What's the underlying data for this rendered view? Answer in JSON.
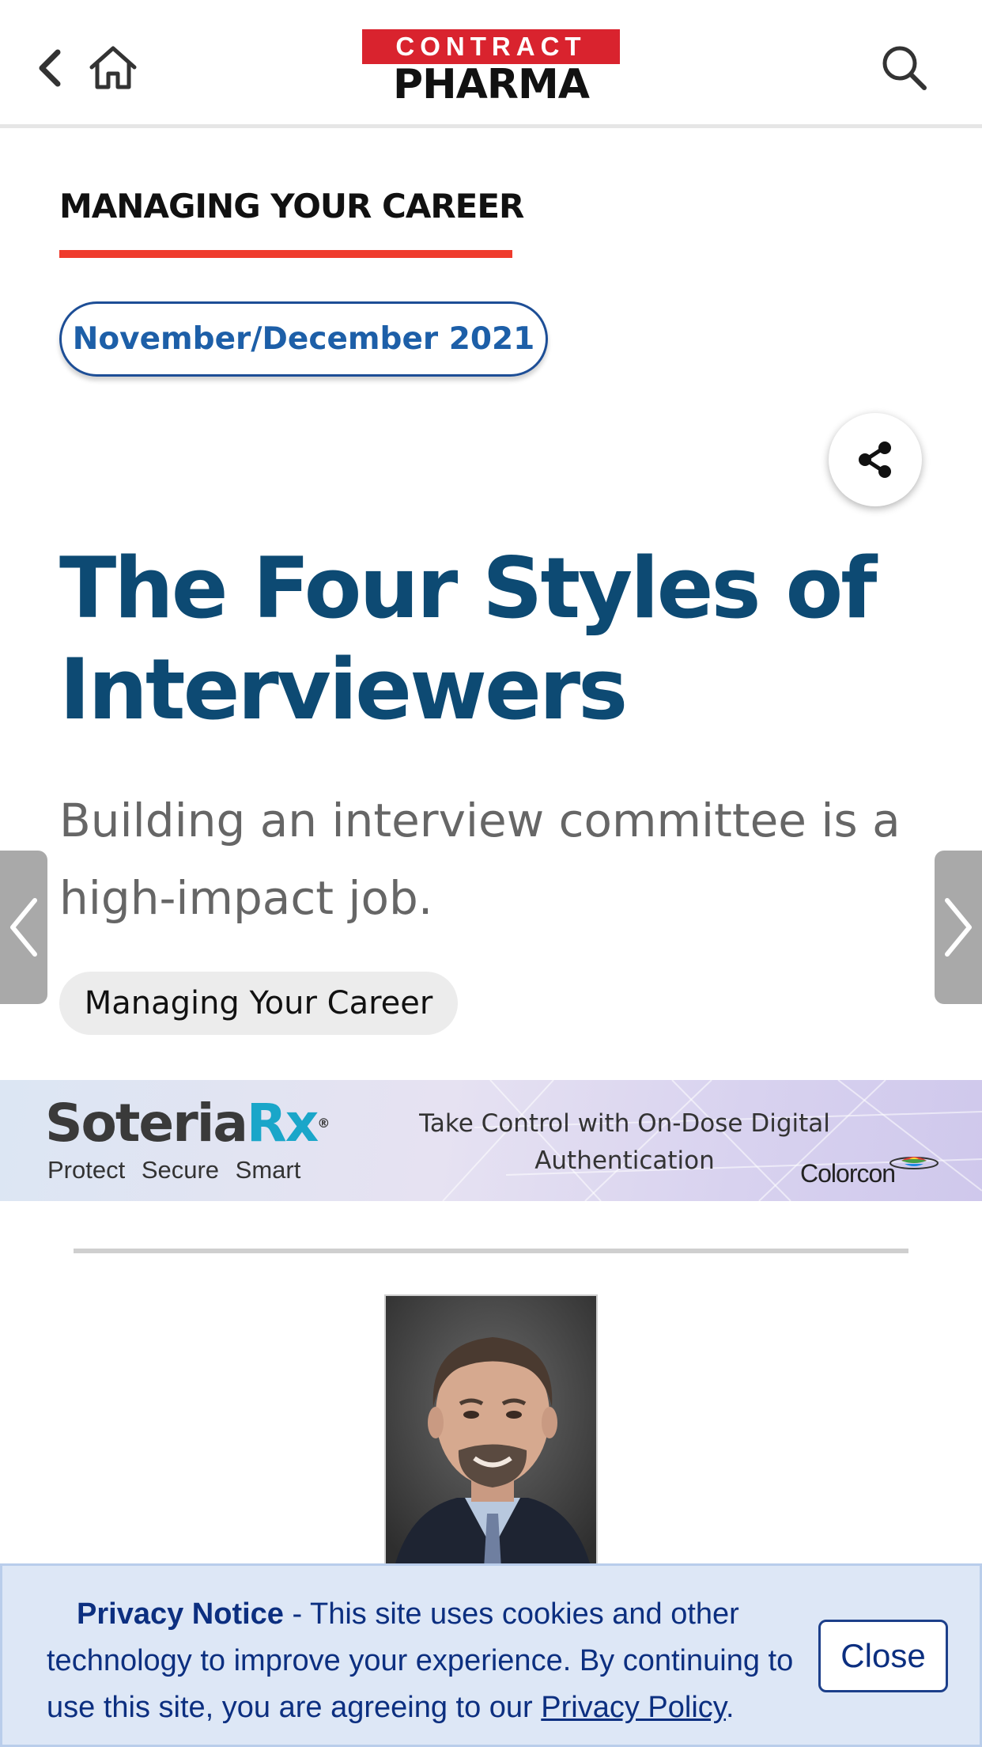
{
  "header": {
    "logo_top": "CONTRACT",
    "logo_bottom": "PHARMA",
    "back_icon": "chevron-left-icon",
    "home_icon": "home-icon",
    "search_icon": "search-icon"
  },
  "article": {
    "section": "MANAGING YOUR CAREER",
    "issue": "November/December 2021",
    "title": "The Four Styles of Interviewers",
    "subtitle": "Building an interview committee is a high-impact job.",
    "tag": "Managing Your Career",
    "share_icon": "share-icon"
  },
  "ad": {
    "brand_main": "Soteria",
    "brand_rx": "Rx",
    "brand_reg": "®",
    "tagline": "Protect Secure Smart",
    "text": "Take Control with On-Dose Digital Authentication",
    "sponsor": "Colorcon"
  },
  "privacy": {
    "label": "Privacy Notice",
    "text": " - This site uses cookies and other technology to improve your experience. By continuing to use this site, you are agreeing to our ",
    "link": "Privacy Policy",
    "end": ".",
    "close_label": "Close"
  },
  "colors": {
    "accent_red": "#ef3b2d",
    "title_blue": "#0d4a73",
    "link_blue": "#1d5fa8",
    "privacy_bg": "#dde7f6"
  }
}
